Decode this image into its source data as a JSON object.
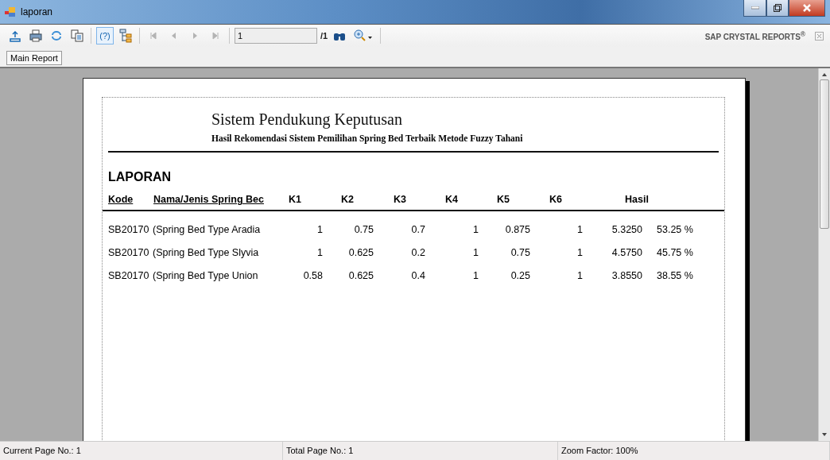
{
  "window": {
    "title": "laporan"
  },
  "toolbar": {
    "buttons": [
      {
        "kind": "export",
        "disabled": false,
        "selected": false
      },
      {
        "kind": "print",
        "disabled": false,
        "selected": false
      },
      {
        "kind": "refresh",
        "disabled": false,
        "selected": false
      },
      {
        "kind": "copy",
        "disabled": false,
        "selected": false
      },
      {
        "kind": "help",
        "label": "(?)",
        "disabled": false,
        "selected": true
      },
      {
        "kind": "tree",
        "disabled": false,
        "selected": false
      },
      {
        "kind": "first",
        "disabled": true,
        "selected": false
      },
      {
        "kind": "prev",
        "disabled": true,
        "selected": false
      },
      {
        "kind": "next",
        "disabled": true,
        "selected": false
      },
      {
        "kind": "last",
        "disabled": true,
        "selected": false
      }
    ],
    "page_field": {
      "value": "1"
    },
    "page_total": "/1",
    "brand": "SAP CRYSTAL REPORTS",
    "brand_mark": "®"
  },
  "tabs": [
    {
      "label": "Main Report",
      "selected": true
    }
  ],
  "report": {
    "title": "Sistem Pendukung Keputusan",
    "subtitle": "Hasil Rekomendasi Sistem Pemilihan Spring Bed Terbaik Metode Fuzzy Tahani",
    "section": "LAPORAN",
    "columns": [
      {
        "label": "Kode",
        "underlined": true
      },
      {
        "label": "Nama/Jenis Spring Bec",
        "underlined": true
      },
      {
        "label": "K1",
        "underlined": false
      },
      {
        "label": "K2",
        "underlined": false
      },
      {
        "label": "K3",
        "underlined": false
      },
      {
        "label": "K4",
        "underlined": false
      },
      {
        "label": "K5",
        "underlined": false
      },
      {
        "label": "K6",
        "underlined": false
      },
      {
        "label": "Hasil",
        "underlined": false
      }
    ],
    "rows": [
      [
        "SB20170",
        "(Spring Bed Type Aradia",
        "1",
        "0.75",
        "0.7",
        "1",
        "0.875",
        "1",
        "5.3250",
        "53.25 %"
      ],
      [
        "SB20170",
        "(Spring Bed Type Slyvia",
        "1",
        "0.625",
        "0.2",
        "1",
        "0.75",
        "1",
        "4.5750",
        "45.75 %"
      ],
      [
        "SB20170",
        "(Spring Bed Type Union",
        "0.58",
        "0.625",
        "0.4",
        "1",
        "0.25",
        "1",
        "3.8550",
        "38.55 %"
      ]
    ]
  },
  "status_bar": [
    "Current Page No.: 1",
    "Total Page No.: 1",
    "Zoom Factor: 100%"
  ]
}
